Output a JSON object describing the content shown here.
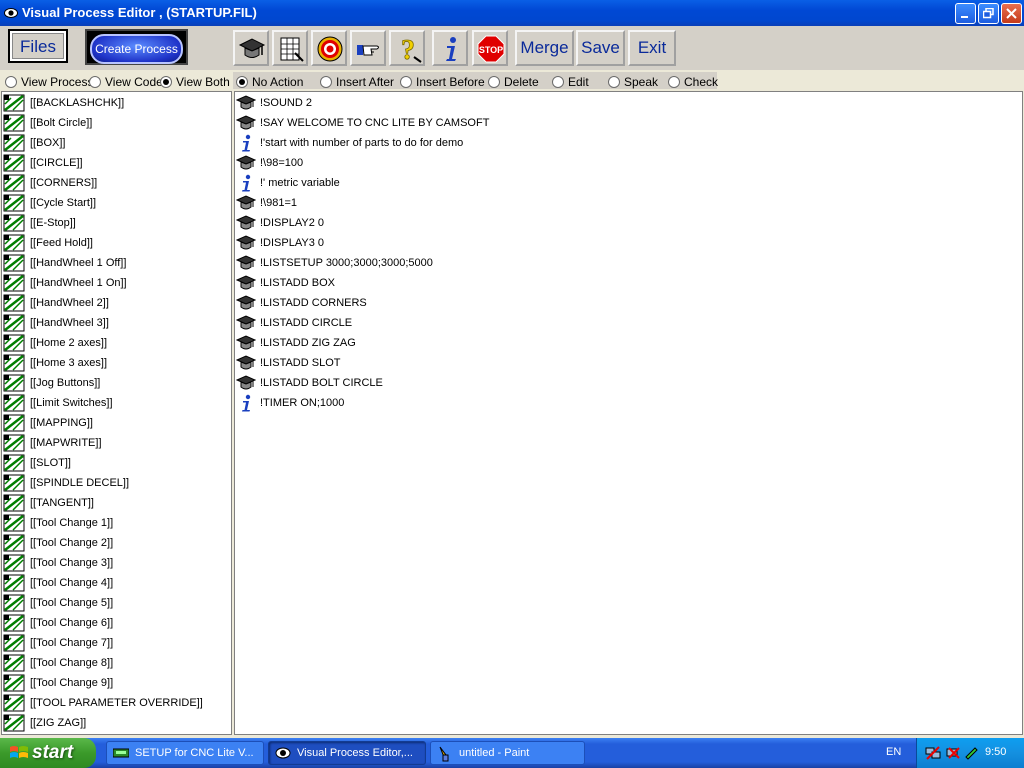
{
  "window": {
    "title": "Visual Process Editor , (STARTUP.FIL)"
  },
  "toolbar": {
    "files_label": "Files",
    "create_label": "Create Process",
    "icon_buttons": [
      "graduation-cap-icon",
      "notepad-grid-icon",
      "target-icon",
      "pointing-hand-icon",
      "question-mark-icon",
      "info-icon",
      "stop-sign-icon"
    ],
    "stop_label": "STOP",
    "merge_label": "Merge",
    "save_label": "Save",
    "exit_label": "Exit"
  },
  "view_options": {
    "items": [
      {
        "label": "View Process",
        "selected": false
      },
      {
        "label": "View Code",
        "selected": false
      },
      {
        "label": "View Both",
        "selected": true
      }
    ]
  },
  "action_options": {
    "items": [
      {
        "label": "No Action",
        "selected": true
      },
      {
        "label": "Insert After",
        "selected": false
      },
      {
        "label": "Insert Before",
        "selected": false
      },
      {
        "label": "Delete",
        "selected": false
      },
      {
        "label": "Edit",
        "selected": false
      },
      {
        "label": "Speak",
        "selected": false
      },
      {
        "label": "Check",
        "selected": false
      }
    ]
  },
  "process_list": [
    "[[BACKLASHCHK]]",
    "[[Bolt Circle]]",
    "[[BOX]]",
    "[[CIRCLE]]",
    "[[CORNERS]]",
    "[[Cycle Start]]",
    "[[E-Stop]]",
    "[[Feed Hold]]",
    "[[HandWheel 1 Off]]",
    "[[HandWheel 1 On]]",
    "[[HandWheel 2]]",
    "[[HandWheel 3]]",
    "[[Home 2 axes]]",
    "[[Home 3 axes]]",
    "[[Jog Buttons]]",
    "[[Limit Switches]]",
    "[[MAPPING]]",
    "[[MAPWRITE]]",
    "[[SLOT]]",
    "[[SPINDLE DECEL]]",
    "[[TANGENT]]",
    "[[Tool Change 1]]",
    "[[Tool Change 2]]",
    "[[Tool Change 3]]",
    "[[Tool Change 4]]",
    "[[Tool Change 5]]",
    "[[Tool Change 6]]",
    "[[Tool Change 7]]",
    "[[Tool Change 8]]",
    "[[Tool Change 9]]",
    "[[TOOL PARAMETER OVERRIDE]]",
    "[[ZIG ZAG]]"
  ],
  "code_lines": [
    {
      "icon": "graduation-cap-icon",
      "text": "!SOUND 2"
    },
    {
      "icon": "graduation-cap-icon",
      "text": "!SAY WELCOME TO CNC LITE BY CAMSOFT"
    },
    {
      "icon": "info-icon",
      "text": "!'start with number of parts to do for demo"
    },
    {
      "icon": "graduation-cap-icon",
      "text": "!\\98=100"
    },
    {
      "icon": "info-icon",
      "text": "!' metric variable"
    },
    {
      "icon": "graduation-cap-icon",
      "text": "!\\981=1"
    },
    {
      "icon": "graduation-cap-icon",
      "text": "!DISPLAY2 0"
    },
    {
      "icon": "graduation-cap-icon",
      "text": "!DISPLAY3 0"
    },
    {
      "icon": "graduation-cap-icon",
      "text": "!LISTSETUP 3000;3000;3000;5000"
    },
    {
      "icon": "graduation-cap-icon",
      "text": "!LISTADD BOX"
    },
    {
      "icon": "graduation-cap-icon",
      "text": "!LISTADD CORNERS"
    },
    {
      "icon": "graduation-cap-icon",
      "text": "!LISTADD CIRCLE"
    },
    {
      "icon": "graduation-cap-icon",
      "text": "!LISTADD ZIG ZAG"
    },
    {
      "icon": "graduation-cap-icon",
      "text": "!LISTADD SLOT"
    },
    {
      "icon": "graduation-cap-icon",
      "text": "!LISTADD BOLT CIRCLE"
    },
    {
      "icon": "info-icon",
      "text": "!TIMER ON;1000"
    }
  ],
  "taskbar": {
    "start_label": "start",
    "tasks": [
      {
        "label": "SETUP for CNC Lite V...",
        "active": false
      },
      {
        "label": "Visual Process Editor,...",
        "active": true
      },
      {
        "label": "untitled - Paint",
        "active": false
      }
    ],
    "language": "EN",
    "clock": "9:50"
  },
  "colors": {
    "titlebar": "#0048d4",
    "window_bg": "#ece9d8",
    "toolbar_bg": "#d4d0c8",
    "button_text": "#0a2a9a",
    "taskbar": "#245edb",
    "start_green": "#3b9a2a"
  }
}
